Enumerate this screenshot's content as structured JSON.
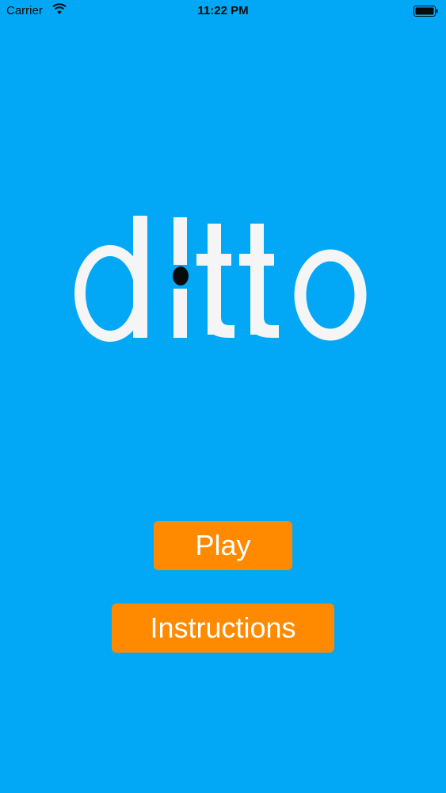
{
  "status_bar": {
    "carrier": "Carrier",
    "time": "11:22 PM",
    "wifi_icon": "wifi-icon",
    "battery_icon": "battery-icon"
  },
  "logo": {
    "text": "ditto",
    "color": "#F5F5F5",
    "dot_color": "#0A0A0A"
  },
  "buttons": {
    "play_label": "Play",
    "instructions_label": "Instructions"
  },
  "colors": {
    "background": "#02A8F6",
    "button": "#FF8A00"
  }
}
